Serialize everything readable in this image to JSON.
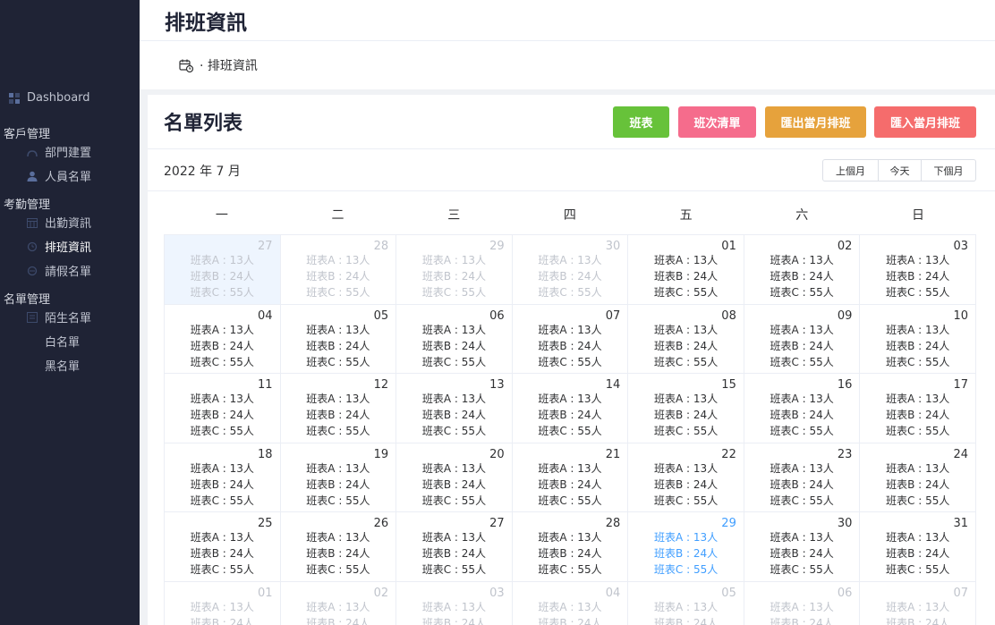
{
  "sidebar": {
    "dashboard": "Dashboard",
    "groups": [
      {
        "label": "客戶管理",
        "items": [
          "部門建置",
          "人員名單"
        ]
      },
      {
        "label": "考勤管理",
        "items": [
          "出勤資訊",
          "排班資訊",
          "請假名單"
        ]
      },
      {
        "label": "名單管理",
        "items": [
          "陌生名單",
          "白名單",
          "黑名單"
        ]
      }
    ],
    "active_item": "排班資訊"
  },
  "header": {
    "title": "排班資訊"
  },
  "breadcrumb": {
    "text": "· 排班資訊"
  },
  "card": {
    "title": "名單列表",
    "buttons": [
      {
        "label": "班表",
        "color": "#67c23a"
      },
      {
        "label": "班次清單",
        "color": "#f56c8c"
      },
      {
        "label": "匯出當月排班",
        "color": "#e6a23c"
      },
      {
        "label": "匯入當月排班",
        "color": "#f56c6c"
      }
    ]
  },
  "calendar": {
    "month_label": "2022 年 7 月",
    "nav": {
      "prev": "上個月",
      "today": "今天",
      "next": "下個月"
    },
    "weekdays": [
      "一",
      "二",
      "三",
      "四",
      "五",
      "六",
      "日"
    ],
    "entries": [
      "班表A : 13人",
      "班表B : 24人",
      "班表C : 55人"
    ],
    "days": [
      {
        "day": "27",
        "state": "prev",
        "selected": true
      },
      {
        "day": "28",
        "state": "prev"
      },
      {
        "day": "29",
        "state": "prev"
      },
      {
        "day": "30",
        "state": "prev"
      },
      {
        "day": "01"
      },
      {
        "day": "02"
      },
      {
        "day": "03"
      },
      {
        "day": "04"
      },
      {
        "day": "05"
      },
      {
        "day": "06"
      },
      {
        "day": "07"
      },
      {
        "day": "08"
      },
      {
        "day": "09"
      },
      {
        "day": "10"
      },
      {
        "day": "11"
      },
      {
        "day": "12"
      },
      {
        "day": "13"
      },
      {
        "day": "14"
      },
      {
        "day": "15"
      },
      {
        "day": "16"
      },
      {
        "day": "17"
      },
      {
        "day": "18"
      },
      {
        "day": "19"
      },
      {
        "day": "20"
      },
      {
        "day": "21"
      },
      {
        "day": "22"
      },
      {
        "day": "23"
      },
      {
        "day": "24"
      },
      {
        "day": "25"
      },
      {
        "day": "26"
      },
      {
        "day": "27"
      },
      {
        "day": "28"
      },
      {
        "day": "29",
        "state": "today"
      },
      {
        "day": "30"
      },
      {
        "day": "31"
      },
      {
        "day": "01",
        "state": "next"
      },
      {
        "day": "02",
        "state": "next"
      },
      {
        "day": "03",
        "state": "next"
      },
      {
        "day": "04",
        "state": "next"
      },
      {
        "day": "05",
        "state": "next"
      },
      {
        "day": "06",
        "state": "next"
      },
      {
        "day": "07",
        "state": "next"
      }
    ]
  }
}
